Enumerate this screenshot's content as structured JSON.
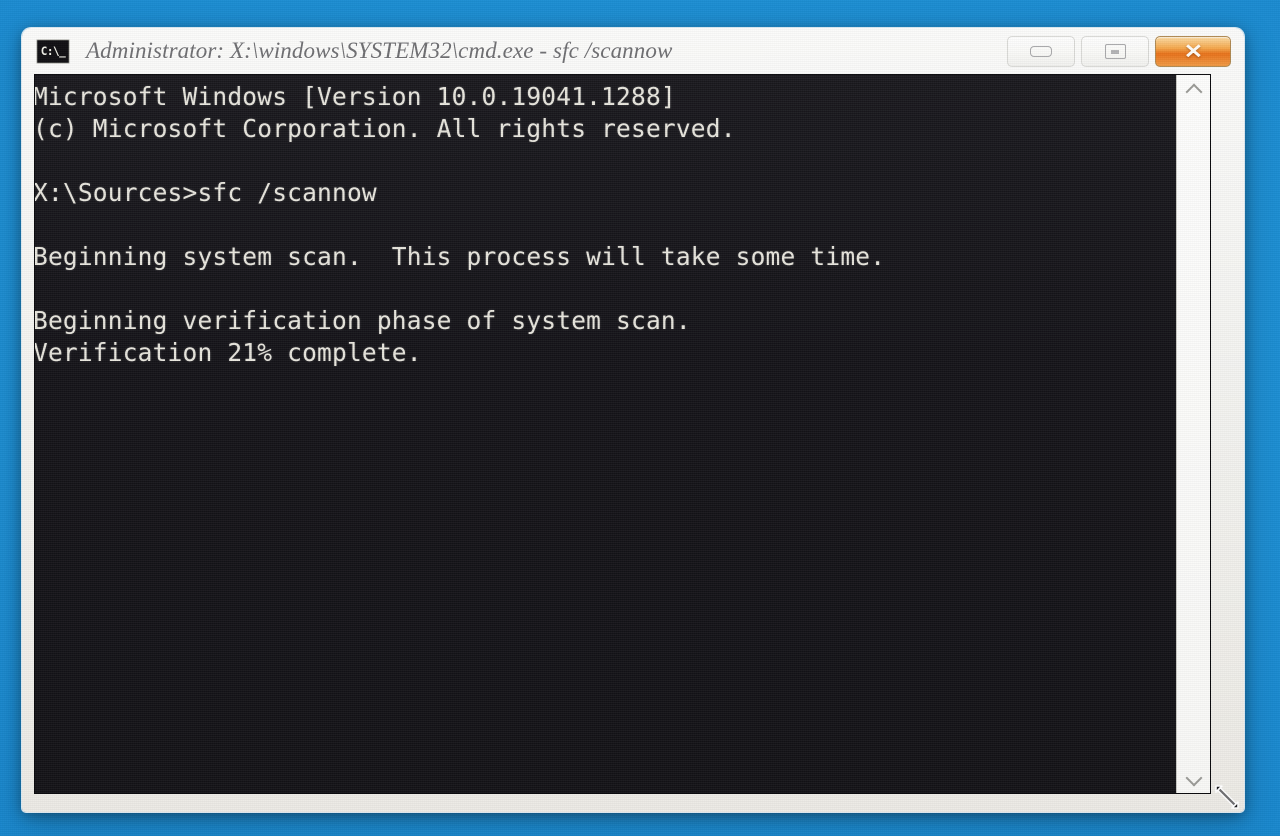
{
  "desktop": {
    "background_color": "#1a8fd2"
  },
  "window": {
    "title": "Administrator: X:\\windows\\SYSTEM32\\cmd.exe - sfc /scannow",
    "icon_name": "cmd-prompt-icon",
    "icon_text": "C:\\_",
    "buttons": {
      "minimize_label": "Minimize",
      "maximize_label": "Maximize",
      "close_label": "✕",
      "close_color": "#e8731c"
    }
  },
  "console": {
    "background_color": "#15141a",
    "text_color": "#e9e7df",
    "lines": [
      "Microsoft Windows [Version 10.0.19041.1288]",
      "(c) Microsoft Corporation. All rights reserved.",
      "",
      "X:\\Sources>sfc /scannow",
      "",
      "Beginning system scan.  This process will take some time.",
      "",
      "Beginning verification phase of system scan.",
      "Verification 21% complete."
    ],
    "text": "Microsoft Windows [Version 10.0.19041.1288]\n(c) Microsoft Corporation. All rights reserved.\n\nX:\\Sources>sfc /scannow\n\nBeginning system scan.  This process will take some time.\n\nBeginning verification phase of system scan.\nVerification 21% complete.",
    "command": "sfc /scannow",
    "prompt": "X:\\Sources>",
    "windows_version": "10.0.19041.1288",
    "progress_percent": "21%",
    "scrollbar": {
      "up_arrow_label": "Scroll up",
      "down_arrow_label": "Scroll down"
    }
  }
}
